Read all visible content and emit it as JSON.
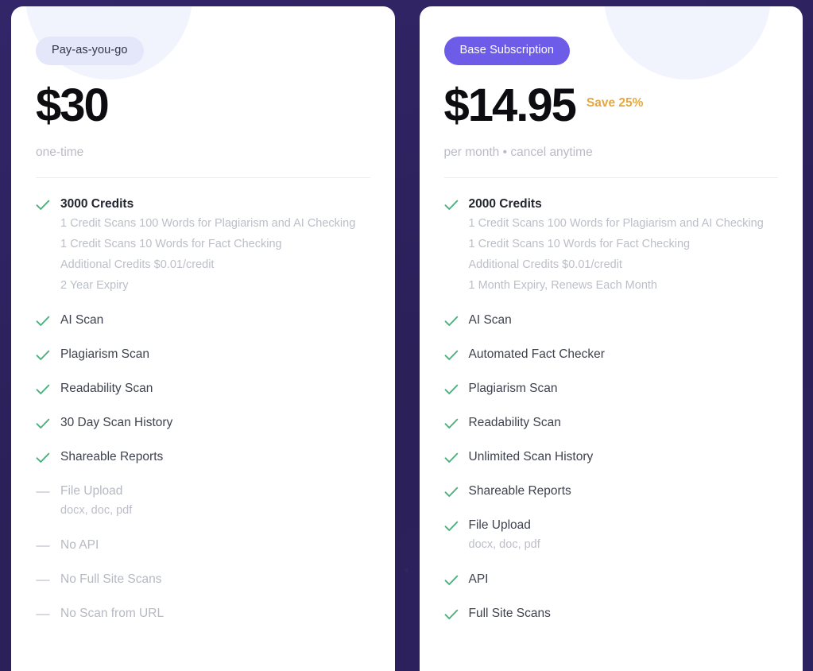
{
  "theme": {
    "background": "#2b2058",
    "card_background": "#ffffff",
    "accent": "#6c5ce7",
    "badge_neutral_bg": "#e3e7f9",
    "check_green": "#4caf7d",
    "save_amber": "#e3a93f",
    "muted_text": "#b9bcc6"
  },
  "plans": [
    {
      "id": "pay-as-you-go",
      "badge": "Pay-as-you-go",
      "badge_style": "neutral",
      "price": "$30",
      "save": "",
      "term": "one-time",
      "features": [
        {
          "mark": "check",
          "title": "3000 Credits",
          "emphasis": true,
          "subs": [
            "1 Credit Scans 100 Words for Plagiarism and AI Checking",
            "1 Credit Scans 10 Words for Fact Checking",
            "Additional Credits $0.01/credit",
            "2 Year Expiry"
          ]
        },
        {
          "mark": "check",
          "title": "AI Scan",
          "subs": []
        },
        {
          "mark": "check",
          "title": "Plagiarism Scan",
          "subs": []
        },
        {
          "mark": "check",
          "title": "Readability Scan",
          "subs": []
        },
        {
          "mark": "check",
          "title": "30 Day Scan History",
          "subs": []
        },
        {
          "mark": "check",
          "title": "Shareable Reports",
          "subs": []
        },
        {
          "mark": "dash",
          "title": "File Upload",
          "disabled": true,
          "subs": [
            "docx, doc, pdf"
          ]
        },
        {
          "mark": "dash",
          "title": "No API",
          "disabled": true,
          "subs": []
        },
        {
          "mark": "dash",
          "title": "No Full Site Scans",
          "disabled": true,
          "subs": []
        },
        {
          "mark": "dash",
          "title": "No Scan from URL",
          "disabled": true,
          "subs": []
        }
      ]
    },
    {
      "id": "base-subscription",
      "badge": "Base Subscription",
      "badge_style": "accent",
      "price": "$14.95",
      "save": "Save 25%",
      "term": "per month • cancel anytime",
      "features": [
        {
          "mark": "check",
          "title": "2000 Credits",
          "emphasis": true,
          "subs": [
            "1 Credit Scans 100 Words for Plagiarism and AI Checking",
            "1 Credit Scans 10 Words for Fact Checking",
            "Additional Credits $0.01/credit",
            "1 Month Expiry, Renews Each Month"
          ]
        },
        {
          "mark": "check",
          "title": "AI Scan",
          "subs": []
        },
        {
          "mark": "check",
          "title": "Automated Fact Checker",
          "subs": []
        },
        {
          "mark": "check",
          "title": "Plagiarism Scan",
          "subs": []
        },
        {
          "mark": "check",
          "title": "Readability Scan",
          "subs": []
        },
        {
          "mark": "check",
          "title": "Unlimited Scan History",
          "subs": []
        },
        {
          "mark": "check",
          "title": "Shareable Reports",
          "subs": []
        },
        {
          "mark": "check",
          "title": "File Upload",
          "subs": [
            "docx, doc, pdf"
          ]
        },
        {
          "mark": "check",
          "title": "API",
          "subs": []
        },
        {
          "mark": "check",
          "title": "Full Site Scans",
          "subs": []
        }
      ]
    }
  ],
  "icons": {
    "check": "check-icon",
    "dash": "dash-icon"
  }
}
